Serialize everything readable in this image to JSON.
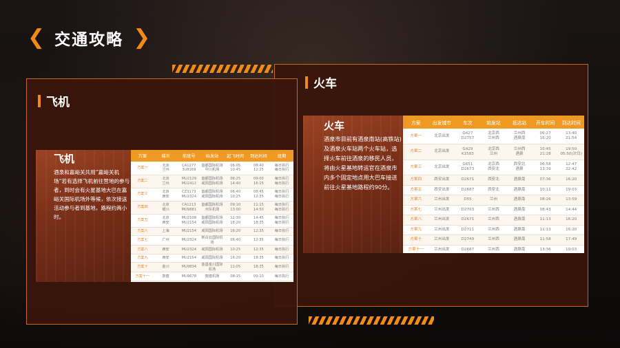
{
  "header": {
    "title": "交通攻略",
    "left_chevron": "❮",
    "right_chevron": "❯"
  },
  "colors": {
    "accent": "#f28a1a",
    "panel": "#3a160a",
    "table_head": "#ee9a22"
  },
  "plane": {
    "heading": "飞机",
    "card_title": "飞机",
    "card_text": "酒泉和嘉峪关共用“嘉峪关机场”若有选择飞机前往营地的参与者，到时会有火星基地大巴在嘉峪关国际机场外等候，依次接送活动参与者到基地，路程约两小时。",
    "columns": [
      "方案",
      "城市",
      "航班号",
      "始发站",
      "起飞时间",
      "到达时间",
      "班期"
    ],
    "rows": [
      [
        "方案一",
        "北京\n兰州",
        "CA1277\n3U8169",
        "首都国际机场\n中川机场",
        "06:05\n10:45",
        "08:40\n12:25",
        "每日执行\n每日执行"
      ],
      [
        "方案二",
        "北京\n兰州",
        "MU2129\nMU2412",
        "首都国际机场\n咸阳国际机场",
        "06:25\n14:40",
        "09:00\n16:15",
        "每日执行\n每日执行"
      ],
      [
        "方案三",
        "北京\n西安",
        "CZ3173\nMU2324",
        "首都国际机场\n咸阳国际机场",
        "06:40\n10:25",
        "08:45\n12:35",
        "每日执行\n每日执行"
      ],
      [
        "方案四",
        "北京\n银川",
        "CA1213\nMU9881",
        "首都国际机场\n河东机场",
        "09:10\n13:00",
        "11:15\n14:50",
        "每日执行\n每日执行"
      ],
      [
        "方案五",
        "北京\n西安",
        "MU2108\nMU2154",
        "首都国际机场\n咸阳国际机场",
        "12:30\n16:20",
        "14:45\n18:35",
        "每日执行\n每日执行"
      ],
      [
        "方案六",
        "上海",
        "MU2154",
        "咸阳国际机场",
        "16:20",
        "12:35",
        "每日执行"
      ],
      [
        "方案七",
        "广州",
        "MU2324",
        "新白云国际机场",
        "06:40",
        "12:35",
        "每日执行"
      ],
      [
        "方案八",
        "西安",
        "MU2324",
        "咸阳国际机场",
        "10:25",
        "12:35",
        "每日执行"
      ],
      [
        "方案九",
        "西安",
        "MU2154",
        "咸阳国际机场",
        "16:20",
        "18:35",
        "每日执行"
      ],
      [
        "方案十",
        "金川",
        "MU9834",
        "金昌金川国际机场",
        "11:05",
        "18:35",
        "每日执行"
      ],
      [
        "方案十一",
        "敦煌",
        "MU9678",
        "敦煌机场",
        "08:15",
        "09:10",
        "每日执行"
      ]
    ]
  },
  "train": {
    "heading": "火车",
    "card_title": "火车",
    "card_text": "酒泉市目前有酒泉南站(高铁站)及酒泉火车站两个火车站，选择火车前往酒泉的移民人员，将由火星基地转运官在酒泉市内多个固定地点用大巴车接送前往火星基地路程约90分。",
    "columns": [
      "方案",
      "出发城市",
      "车次",
      "始发站",
      "抵达站",
      "开车时间",
      "到达时间"
    ],
    "rows": [
      [
        "方案一",
        "北京出发",
        "G427\nD2757",
        "北京西\n兰州西",
        "兰州西\n酒泉南",
        "06:27\n16:20",
        "13:40\n21:54"
      ],
      [
        "方案二",
        "北京出发",
        "G429\nK1583",
        "北京西\n兰州",
        "兰州西\n酒泉",
        "10:45\n21:28",
        "19:50\n05:50(次日)"
      ],
      [
        "方案三",
        "北京出发",
        "G651\nD2673",
        "北京西\n西安北",
        "西安北\n酒泉",
        "06:58\n13:39",
        "12:47\n22:42"
      ],
      [
        "方案四",
        "西安出发",
        "D2671",
        "西安北",
        "酒泉南",
        "07:36",
        "16:20"
      ],
      [
        "方案五",
        "西安出发",
        "D2687",
        "西安北",
        "酒泉南",
        "10:11",
        "19:03"
      ],
      [
        "方案六",
        "兰州出发",
        "D55",
        "兰州",
        "酒泉南",
        "08:26",
        "13:59"
      ],
      [
        "方案七",
        "兰州出发",
        "D2703",
        "兰州西",
        "酒泉南",
        "08:43",
        "14:44"
      ],
      [
        "方案八",
        "兰州出发",
        "D2671",
        "兰州西",
        "酒泉南",
        "11:13",
        "16:20"
      ],
      [
        "方案九",
        "兰州出发",
        "D2711",
        "兰州西",
        "酒泉南",
        "11:13",
        "16:20"
      ],
      [
        "方案十",
        "兰州出发",
        "D2749",
        "兰州西",
        "酒泉南",
        "11:58",
        "17:49"
      ],
      [
        "方案十一",
        "兰州出发",
        "D2687",
        "兰州西",
        "酒泉南",
        "13:36",
        "19:03"
      ]
    ]
  }
}
